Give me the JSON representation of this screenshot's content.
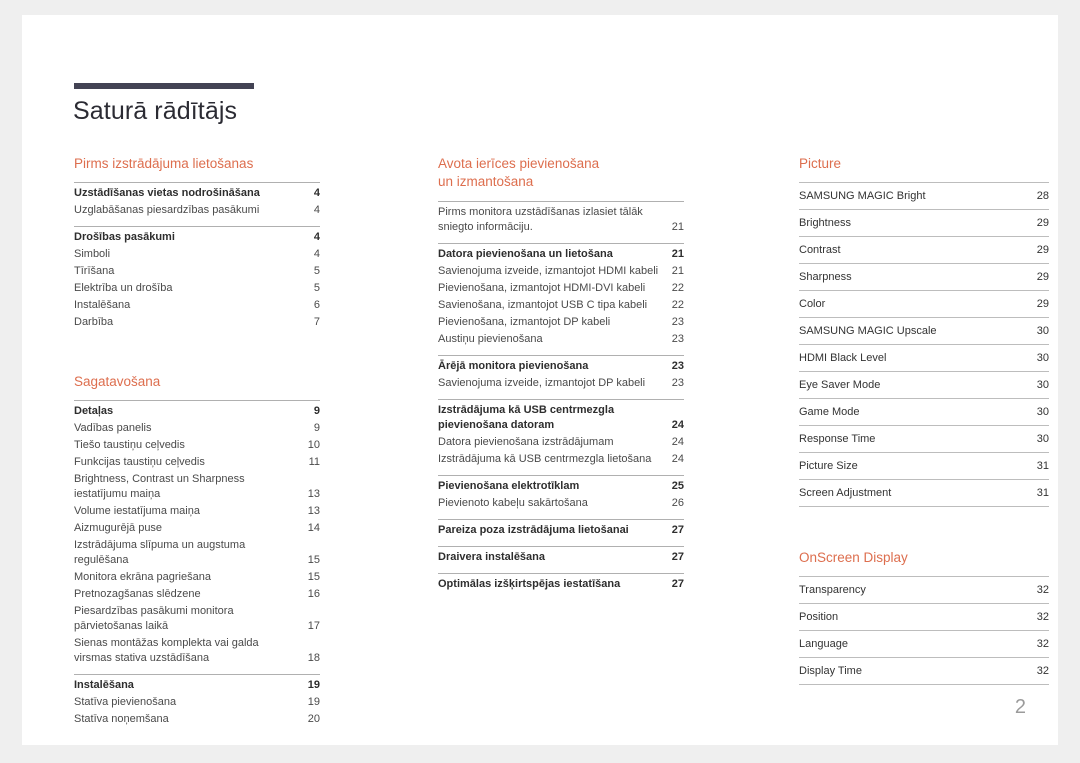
{
  "document": {
    "title": "Saturā rādītājs",
    "page_number": "2",
    "accent_color": "#dd6e4e",
    "rule_color": "#434354"
  },
  "columns": [
    {
      "name": "column-1",
      "sections": [
        {
          "title": "Pirms izstrādājuma lietošanas",
          "groups": [
            {
              "rows": [
                {
                  "label": "Uzstādīšanas vietas nodrošināšana",
                  "page": "4",
                  "bold": true
                },
                {
                  "label": "Uzglabāšanas piesardzības pasākumi",
                  "page": "4",
                  "bold": false
                }
              ]
            },
            {
              "rows": [
                {
                  "label": "Drošības pasākumi",
                  "page": "4",
                  "bold": true
                },
                {
                  "label": "Simboli",
                  "page": "4",
                  "bold": false
                },
                {
                  "label": "Tīrīšana",
                  "page": "5",
                  "bold": false
                },
                {
                  "label": "Elektrība un drošība",
                  "page": "5",
                  "bold": false
                },
                {
                  "label": "Instalēšana",
                  "page": "6",
                  "bold": false
                },
                {
                  "label": "Darbība",
                  "page": "7",
                  "bold": false
                }
              ]
            }
          ]
        },
        {
          "title": "Sagatavošana",
          "groups": [
            {
              "rows": [
                {
                  "label": "Detaļas",
                  "page": "9",
                  "bold": true
                },
                {
                  "label": "Vadības panelis",
                  "page": "9",
                  "bold": false
                },
                {
                  "label": "Tiešo taustiņu ceļvedis",
                  "page": "10",
                  "bold": false
                },
                {
                  "label": "Funkcijas taustiņu ceļvedis",
                  "page": "11",
                  "bold": false
                },
                {
                  "label": "Brightness, Contrast un Sharpness iestatījumu maiņa",
                  "page": "13",
                  "bold": false
                },
                {
                  "label": "Volume iestatījuma maiņa",
                  "page": "13",
                  "bold": false
                },
                {
                  "label": "Aizmugurējā puse",
                  "page": "14",
                  "bold": false
                },
                {
                  "label": "Izstrādājuma slīpuma un augstuma regulēšana",
                  "page": "15",
                  "bold": false
                },
                {
                  "label": "Monitora ekrāna pagriešana",
                  "page": "15",
                  "bold": false
                },
                {
                  "label": "Pretnozagšanas slēdzene",
                  "page": "16",
                  "bold": false
                },
                {
                  "label": "Piesardzības pasākumi monitora pārvietošanas laikā",
                  "page": "17",
                  "bold": false
                },
                {
                  "label": "Sienas montāžas komplekta vai galda virsmas stativa uzstādīšana",
                  "page": "18",
                  "bold": false
                }
              ]
            },
            {
              "rows": [
                {
                  "label": "Instalēšana",
                  "page": "19",
                  "bold": true
                },
                {
                  "label": "Statīva pievienošana",
                  "page": "19",
                  "bold": false
                },
                {
                  "label": "Statīva noņemšana",
                  "page": "20",
                  "bold": false
                }
              ]
            }
          ]
        }
      ]
    },
    {
      "name": "column-2",
      "sections": [
        {
          "title": "Avota ierīces pievienošana\nun izmantošana",
          "groups": [
            {
              "rows": [
                {
                  "label": "Pirms monitora uzstādīšanas izlasiet tālāk sniegto informāciju.",
                  "page": "21",
                  "bold": false
                }
              ]
            },
            {
              "rows": [
                {
                  "label": "Datora pievienošana un lietošana",
                  "page": "21",
                  "bold": true
                },
                {
                  "label": "Savienojuma izveide, izmantojot HDMI kabeli",
                  "page": "21",
                  "bold": false
                },
                {
                  "label": "Pievienošana, izmantojot HDMI-DVI kabeli",
                  "page": "22",
                  "bold": false
                },
                {
                  "label": "Savienošana, izmantojot USB C tipa kabeli",
                  "page": "22",
                  "bold": false
                },
                {
                  "label": "Pievienošana, izmantojot DP kabeli",
                  "page": "23",
                  "bold": false
                },
                {
                  "label": "Austiņu pievienošana",
                  "page": "23",
                  "bold": false
                }
              ]
            },
            {
              "rows": [
                {
                  "label": "Ārējā monitora pievienošana",
                  "page": "23",
                  "bold": true
                },
                {
                  "label": "Savienojuma izveide, izmantojot DP kabeli",
                  "page": "23",
                  "bold": false
                }
              ]
            },
            {
              "rows": [
                {
                  "label": "Izstrādājuma kā USB centrmezgla pievienošana datoram",
                  "page": "24",
                  "bold": true
                },
                {
                  "label": "Datora pievienošana izstrādājumam",
                  "page": "24",
                  "bold": false
                },
                {
                  "label": "Izstrādājuma kā USB centrmezgla lietošana",
                  "page": "24",
                  "bold": false
                }
              ]
            },
            {
              "rows": [
                {
                  "label": "Pievienošana elektrotīklam",
                  "page": "25",
                  "bold": true
                },
                {
                  "label": "Pievienoto kabeļu sakārtošana",
                  "page": "26",
                  "bold": false
                }
              ]
            },
            {
              "rows": [
                {
                  "label": "Pareiza poza izstrādājuma lietošanai",
                  "page": "27",
                  "bold": true
                }
              ]
            },
            {
              "rows": [
                {
                  "label": "Draivera instalēšana",
                  "page": "27",
                  "bold": true
                }
              ]
            },
            {
              "rows": [
                {
                  "label": "Optimālas izšķirtspējas iestatīšana",
                  "page": "27",
                  "bold": true
                }
              ]
            }
          ]
        }
      ]
    },
    {
      "name": "column-3",
      "sections": [
        {
          "title": "Picture",
          "groups": [
            {
              "rows": [
                {
                  "label": "SAMSUNG MAGIC Bright",
                  "page": "28",
                  "bold": false
                },
                {
                  "label": "Brightness",
                  "page": "29",
                  "bold": false
                },
                {
                  "label": "Contrast",
                  "page": "29",
                  "bold": false
                },
                {
                  "label": "Sharpness",
                  "page": "29",
                  "bold": false
                },
                {
                  "label": "Color",
                  "page": "29",
                  "bold": false
                },
                {
                  "label": "SAMSUNG MAGIC Upscale",
                  "page": "30",
                  "bold": false
                },
                {
                  "label": "HDMI Black Level",
                  "page": "30",
                  "bold": false
                },
                {
                  "label": "Eye Saver Mode",
                  "page": "30",
                  "bold": false
                },
                {
                  "label": "Game Mode",
                  "page": "30",
                  "bold": false
                },
                {
                  "label": "Response Time",
                  "page": "30",
                  "bold": false
                },
                {
                  "label": "Picture Size",
                  "page": "31",
                  "bold": false
                },
                {
                  "label": "Screen Adjustment",
                  "page": "31",
                  "bold": false
                }
              ]
            }
          ]
        },
        {
          "title": "OnScreen Display",
          "groups": [
            {
              "rows": [
                {
                  "label": "Transparency",
                  "page": "32",
                  "bold": false
                },
                {
                  "label": "Position",
                  "page": "32",
                  "bold": false
                },
                {
                  "label": "Language",
                  "page": "32",
                  "bold": false
                },
                {
                  "label": "Display Time",
                  "page": "32",
                  "bold": false
                }
              ]
            }
          ]
        }
      ]
    }
  ]
}
